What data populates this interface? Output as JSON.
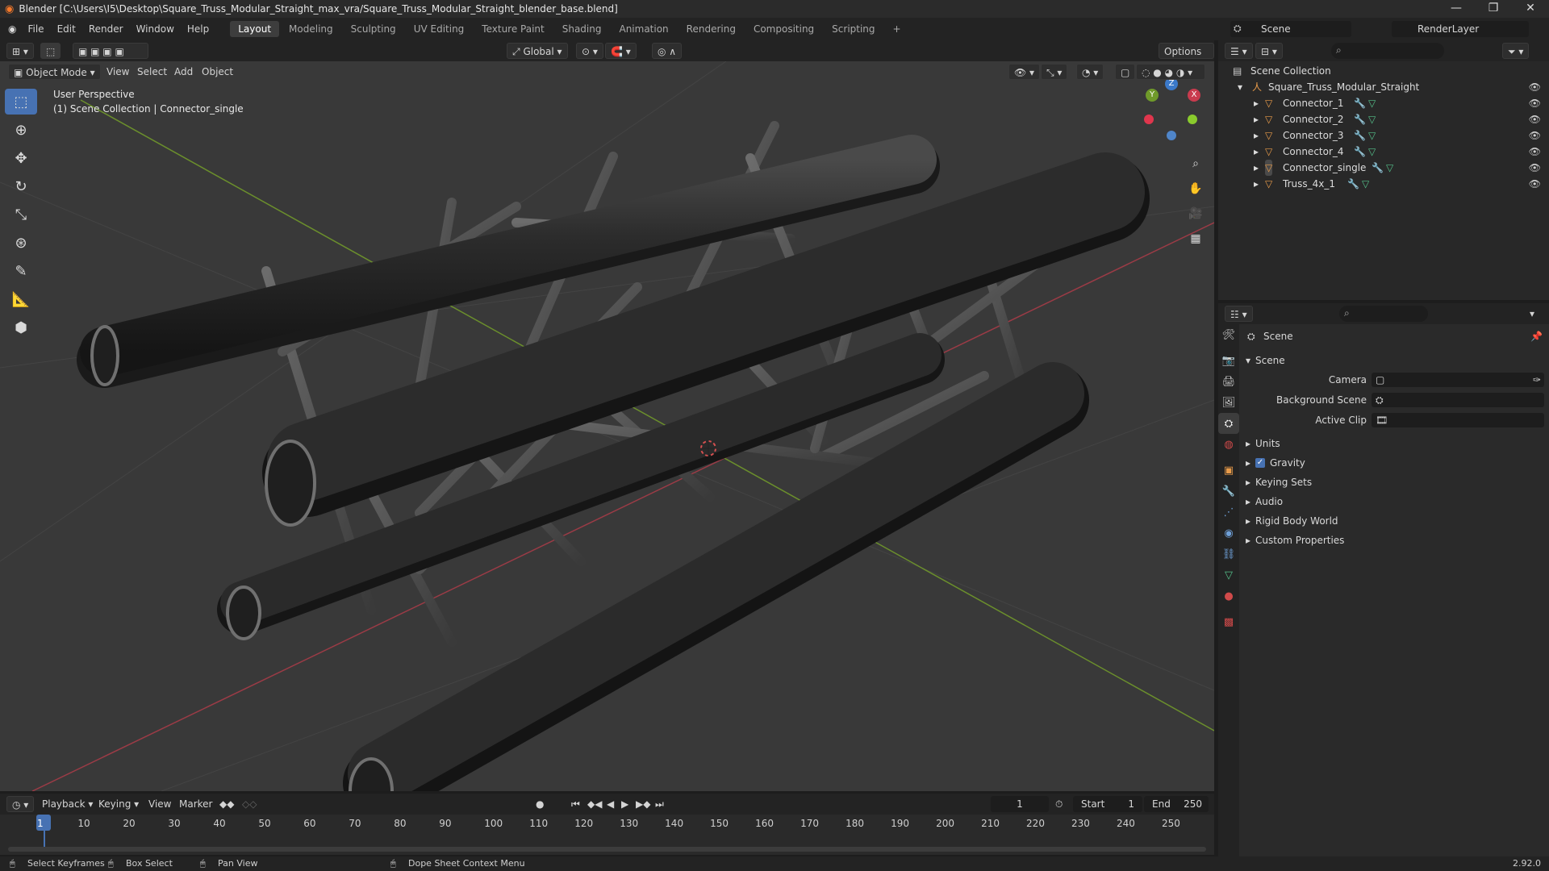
{
  "titlebar": {
    "title": "Blender [C:\\Users\\I5\\Desktop\\Square_Truss_Modular_Straight_max_vra/Square_Truss_Modular_Straight_blender_base.blend]",
    "minimize": "—",
    "maximize": "❐",
    "close": "✕"
  },
  "menubar": {
    "items": [
      "File",
      "Edit",
      "Render",
      "Window",
      "Help"
    ],
    "workspaces": [
      "Layout",
      "Modeling",
      "Sculpting",
      "UV Editing",
      "Texture Paint",
      "Shading",
      "Animation",
      "Rendering",
      "Compositing",
      "Scripting"
    ],
    "active_workspace": "Layout",
    "add_workspace": "+",
    "scene_label": "Scene",
    "renderlayer_label": "RenderLayer"
  },
  "viewport_header": {
    "transform_orientation": "Global",
    "options": "Options",
    "mode": "Object Mode",
    "menus": [
      "View",
      "Select",
      "Add",
      "Object"
    ]
  },
  "viewport": {
    "overlay_line1": "User Perspective",
    "overlay_line2": "(1) Scene Collection | Connector_single",
    "gizmo": {
      "x": "X",
      "y": "Y",
      "z": "Z"
    },
    "axis_colors": {
      "x": "#c93b4e",
      "y": "#6f9a2a",
      "z": "#3b79c9"
    }
  },
  "toolbar": {
    "tools": [
      "select-box",
      "cursor",
      "move",
      "rotate",
      "scale",
      "transform",
      "annotate",
      "measure",
      "add-cube"
    ]
  },
  "outliner": {
    "root": "Scene Collection",
    "collection": "Square_Truss_Modular_Straight",
    "objects": [
      "Connector_1",
      "Connector_2",
      "Connector_3",
      "Connector_4",
      "Connector_single",
      "Truss_4x_1"
    ]
  },
  "properties": {
    "header": "Scene",
    "panel": "Scene",
    "fields": [
      {
        "label": "Camera"
      },
      {
        "label": "Background Scene"
      },
      {
        "label": "Active Clip"
      }
    ],
    "sections": [
      "Units",
      "Gravity",
      "Keying Sets",
      "Audio",
      "Rigid Body World",
      "Custom Properties"
    ],
    "gravity_checked": true
  },
  "timeline": {
    "menus": [
      "Playback",
      "Keying",
      "View",
      "Marker"
    ],
    "current_frame": "1",
    "start_label": "Start",
    "start_value": "1",
    "end_label": "End",
    "end_value": "250",
    "ticks": [
      "1",
      "10",
      "20",
      "30",
      "40",
      "50",
      "60",
      "70",
      "80",
      "90",
      "100",
      "110",
      "120",
      "130",
      "140",
      "150",
      "160",
      "170",
      "180",
      "190",
      "200",
      "210",
      "220",
      "230",
      "240",
      "250"
    ]
  },
  "statusbar": {
    "items": [
      "Select Keyframes",
      "Box Select",
      "Pan View",
      "Dope Sheet Context Menu"
    ],
    "version": "2.92.0"
  }
}
